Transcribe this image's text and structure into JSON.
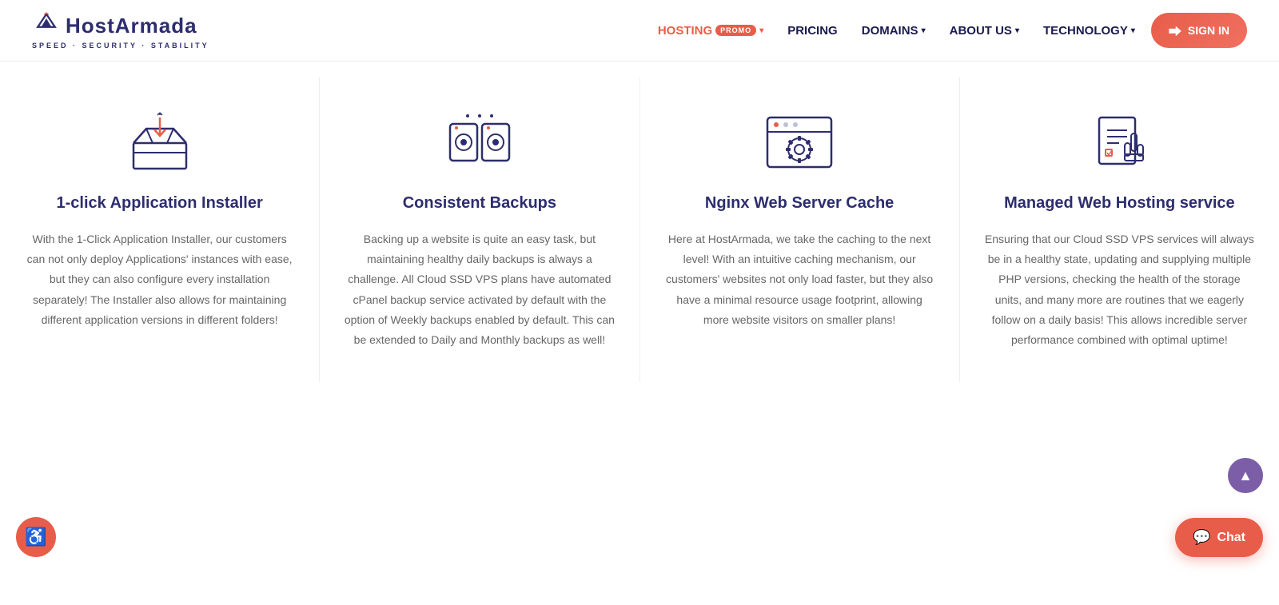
{
  "header": {
    "logo": {
      "name": "HostArmada",
      "tagline": "SPEED · SECURITY · STABILITY"
    },
    "nav": {
      "items": [
        {
          "label": "HOSTING",
          "highlight": true,
          "badge": "PROMO",
          "dropdown": true
        },
        {
          "label": "PRICING",
          "highlight": false,
          "dropdown": false
        },
        {
          "label": "DOMAINS",
          "highlight": false,
          "dropdown": true
        },
        {
          "label": "ABOUT US",
          "highlight": false,
          "dropdown": true
        },
        {
          "label": "TECHNOLOGY",
          "highlight": false,
          "dropdown": true
        }
      ],
      "signin_label": "SIGN IN"
    }
  },
  "features": [
    {
      "id": "app-installer",
      "title": "1-click Application Installer",
      "description": "With the 1-Click Application Installer, our customers can not only deploy Applications' instances with ease, but they can also configure every installation separately! The Installer also allows for maintaining different application versions in different folders!"
    },
    {
      "id": "backups",
      "title": "Consistent Backups",
      "description": "Backing up a website is quite an easy task, but maintaining healthy daily backups is always a challenge. All Cloud SSD VPS plans have automated cPanel backup service activated by default with the option of Weekly backups enabled by default. This can be extended to Daily and Monthly backups as well!"
    },
    {
      "id": "nginx-cache",
      "title": "Nginx Web Server Cache",
      "description": "Here at HostArmada, we take the caching to the next level! With an intuitive caching mechanism, our customers' websites not only load faster, but they also have a minimal resource usage footprint, allowing more website visitors on smaller plans!"
    },
    {
      "id": "managed-hosting",
      "title": "Managed Web Hosting service",
      "description": "Ensuring that our Cloud SSD VPS services will always be in a healthy state, updating and supplying multiple PHP versions, checking the health of the storage units, and many more are routines that we eagerly follow on a daily basis! This allows incredible server performance combined with optimal uptime!"
    }
  ],
  "chat": {
    "label": "Chat"
  },
  "colors": {
    "accent": "#e85d4a",
    "navy": "#2d2d6e",
    "purple": "#7b5ea7"
  }
}
